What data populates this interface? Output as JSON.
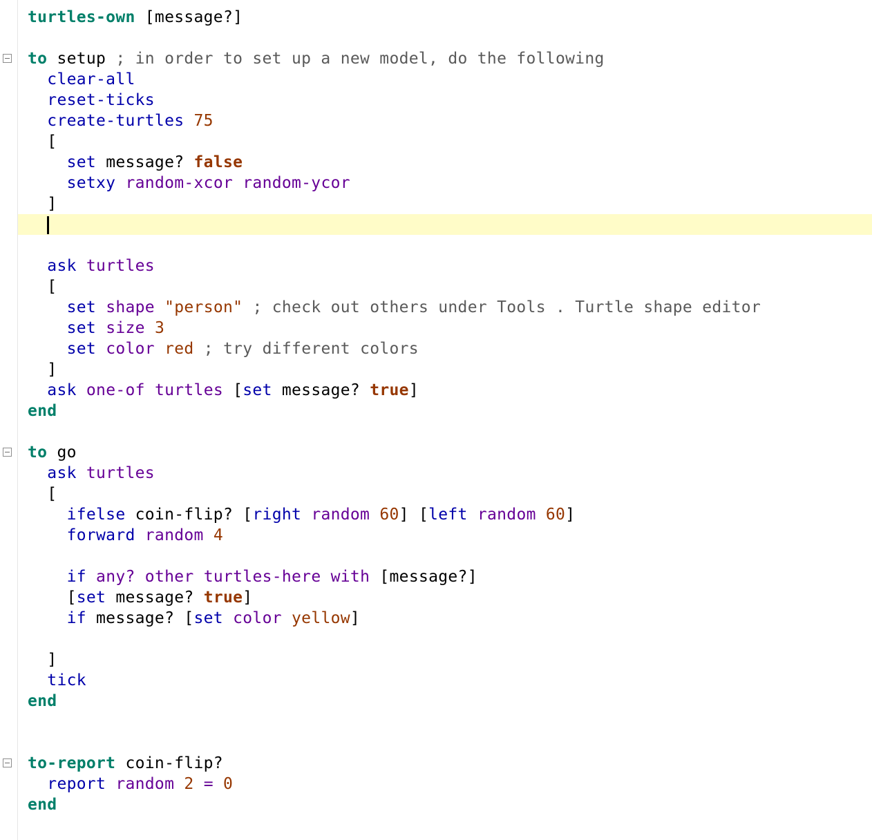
{
  "editor": {
    "lines": [
      [
        {
          "t": "turtles-own",
          "c": "kw"
        },
        {
          "t": " [message?]",
          "c": ""
        }
      ],
      [],
      [
        {
          "t": "to",
          "c": "kw"
        },
        {
          "t": " setup ",
          "c": ""
        },
        {
          "t": "; in order to set up a new model, do the following",
          "c": "cmt"
        }
      ],
      [
        {
          "t": "  ",
          "c": ""
        },
        {
          "t": "clear-all",
          "c": "cmd"
        }
      ],
      [
        {
          "t": "  ",
          "c": ""
        },
        {
          "t": "reset-ticks",
          "c": "cmd"
        }
      ],
      [
        {
          "t": "  ",
          "c": ""
        },
        {
          "t": "create-turtles",
          "c": "cmd"
        },
        {
          "t": " ",
          "c": ""
        },
        {
          "t": "75",
          "c": "num"
        }
      ],
      [
        {
          "t": "  [",
          "c": ""
        }
      ],
      [
        {
          "t": "    ",
          "c": ""
        },
        {
          "t": "set",
          "c": "cmd"
        },
        {
          "t": " message? ",
          "c": ""
        },
        {
          "t": "false",
          "c": "con"
        }
      ],
      [
        {
          "t": "    ",
          "c": ""
        },
        {
          "t": "setxy",
          "c": "cmd"
        },
        {
          "t": " ",
          "c": ""
        },
        {
          "t": "random-xcor",
          "c": "rep"
        },
        {
          "t": " ",
          "c": ""
        },
        {
          "t": "random-ycor",
          "c": "rep"
        }
      ],
      [
        {
          "t": "  ]",
          "c": ""
        }
      ],
      [
        {
          "t": "  ",
          "c": ""
        },
        {
          "t": "",
          "c": "caret"
        }
      ],
      [],
      [
        {
          "t": "  ",
          "c": ""
        },
        {
          "t": "ask",
          "c": "cmd"
        },
        {
          "t": " ",
          "c": ""
        },
        {
          "t": "turtles",
          "c": "rep"
        }
      ],
      [
        {
          "t": "  [",
          "c": ""
        }
      ],
      [
        {
          "t": "    ",
          "c": ""
        },
        {
          "t": "set",
          "c": "cmd"
        },
        {
          "t": " ",
          "c": ""
        },
        {
          "t": "shape",
          "c": "rep"
        },
        {
          "t": " ",
          "c": ""
        },
        {
          "t": "\"person\"",
          "c": "str"
        },
        {
          "t": " ",
          "c": ""
        },
        {
          "t": "; check out others under Tools . Turtle shape editor",
          "c": "cmt"
        }
      ],
      [
        {
          "t": "    ",
          "c": ""
        },
        {
          "t": "set",
          "c": "cmd"
        },
        {
          "t": " ",
          "c": ""
        },
        {
          "t": "size",
          "c": "rep"
        },
        {
          "t": " ",
          "c": ""
        },
        {
          "t": "3",
          "c": "num"
        }
      ],
      [
        {
          "t": "    ",
          "c": ""
        },
        {
          "t": "set",
          "c": "cmd"
        },
        {
          "t": " ",
          "c": ""
        },
        {
          "t": "color",
          "c": "rep"
        },
        {
          "t": " ",
          "c": ""
        },
        {
          "t": "red",
          "c": "num"
        },
        {
          "t": " ",
          "c": ""
        },
        {
          "t": "; try different colors",
          "c": "cmt"
        }
      ],
      [
        {
          "t": "  ]",
          "c": ""
        }
      ],
      [
        {
          "t": "  ",
          "c": ""
        },
        {
          "t": "ask",
          "c": "cmd"
        },
        {
          "t": " ",
          "c": ""
        },
        {
          "t": "one-of",
          "c": "rep"
        },
        {
          "t": " ",
          "c": ""
        },
        {
          "t": "turtles",
          "c": "rep"
        },
        {
          "t": " [",
          "c": ""
        },
        {
          "t": "set",
          "c": "cmd"
        },
        {
          "t": " message? ",
          "c": ""
        },
        {
          "t": "true",
          "c": "con"
        },
        {
          "t": "]",
          "c": ""
        }
      ],
      [
        {
          "t": "end",
          "c": "kw"
        }
      ],
      [],
      [
        {
          "t": "to",
          "c": "kw"
        },
        {
          "t": " go",
          "c": ""
        }
      ],
      [
        {
          "t": "  ",
          "c": ""
        },
        {
          "t": "ask",
          "c": "cmd"
        },
        {
          "t": " ",
          "c": ""
        },
        {
          "t": "turtles",
          "c": "rep"
        }
      ],
      [
        {
          "t": "  [",
          "c": ""
        }
      ],
      [
        {
          "t": "    ",
          "c": ""
        },
        {
          "t": "ifelse",
          "c": "cmd"
        },
        {
          "t": " coin-flip? [",
          "c": ""
        },
        {
          "t": "right",
          "c": "cmd"
        },
        {
          "t": " ",
          "c": ""
        },
        {
          "t": "random",
          "c": "rep"
        },
        {
          "t": " ",
          "c": ""
        },
        {
          "t": "60",
          "c": "num"
        },
        {
          "t": "] [",
          "c": ""
        },
        {
          "t": "left",
          "c": "cmd"
        },
        {
          "t": " ",
          "c": ""
        },
        {
          "t": "random",
          "c": "rep"
        },
        {
          "t": " ",
          "c": ""
        },
        {
          "t": "60",
          "c": "num"
        },
        {
          "t": "]",
          "c": ""
        }
      ],
      [
        {
          "t": "    ",
          "c": ""
        },
        {
          "t": "forward",
          "c": "cmd"
        },
        {
          "t": " ",
          "c": ""
        },
        {
          "t": "random",
          "c": "rep"
        },
        {
          "t": " ",
          "c": ""
        },
        {
          "t": "4",
          "c": "num"
        }
      ],
      [],
      [
        {
          "t": "    ",
          "c": ""
        },
        {
          "t": "if",
          "c": "cmd"
        },
        {
          "t": " ",
          "c": ""
        },
        {
          "t": "any?",
          "c": "rep"
        },
        {
          "t": " ",
          "c": ""
        },
        {
          "t": "other",
          "c": "rep"
        },
        {
          "t": " ",
          "c": ""
        },
        {
          "t": "turtles-here",
          "c": "rep"
        },
        {
          "t": " ",
          "c": ""
        },
        {
          "t": "with",
          "c": "rep"
        },
        {
          "t": " [message?]",
          "c": ""
        }
      ],
      [
        {
          "t": "    [",
          "c": ""
        },
        {
          "t": "set",
          "c": "cmd"
        },
        {
          "t": " message? ",
          "c": ""
        },
        {
          "t": "true",
          "c": "con"
        },
        {
          "t": "]",
          "c": ""
        }
      ],
      [
        {
          "t": "    ",
          "c": ""
        },
        {
          "t": "if",
          "c": "cmd"
        },
        {
          "t": " message? [",
          "c": ""
        },
        {
          "t": "set",
          "c": "cmd"
        },
        {
          "t": " ",
          "c": ""
        },
        {
          "t": "color",
          "c": "rep"
        },
        {
          "t": " ",
          "c": ""
        },
        {
          "t": "yellow",
          "c": "num"
        },
        {
          "t": "]",
          "c": ""
        }
      ],
      [],
      [
        {
          "t": "  ]",
          "c": ""
        }
      ],
      [
        {
          "t": "  ",
          "c": ""
        },
        {
          "t": "tick",
          "c": "cmd"
        }
      ],
      [
        {
          "t": "end",
          "c": "kw"
        }
      ],
      [],
      [],
      [
        {
          "t": "to-report",
          "c": "kw"
        },
        {
          "t": " coin-flip?",
          "c": ""
        }
      ],
      [
        {
          "t": "  ",
          "c": ""
        },
        {
          "t": "report",
          "c": "cmd"
        },
        {
          "t": " ",
          "c": ""
        },
        {
          "t": "random",
          "c": "rep"
        },
        {
          "t": " ",
          "c": ""
        },
        {
          "t": "2",
          "c": "num"
        },
        {
          "t": " ",
          "c": ""
        },
        {
          "t": "=",
          "c": "rep"
        },
        {
          "t": " ",
          "c": ""
        },
        {
          "t": "0",
          "c": "num"
        }
      ],
      [
        {
          "t": "end",
          "c": "kw"
        }
      ]
    ],
    "current_line": 10,
    "fold_lines": [
      2,
      21,
      36
    ],
    "colors": {
      "keyword": "#007f69",
      "command": "#0000aa",
      "reporter": "#660096",
      "constant": "#963700",
      "comment": "#5a5a5a",
      "current_line_bg": "#fffcc8"
    }
  }
}
